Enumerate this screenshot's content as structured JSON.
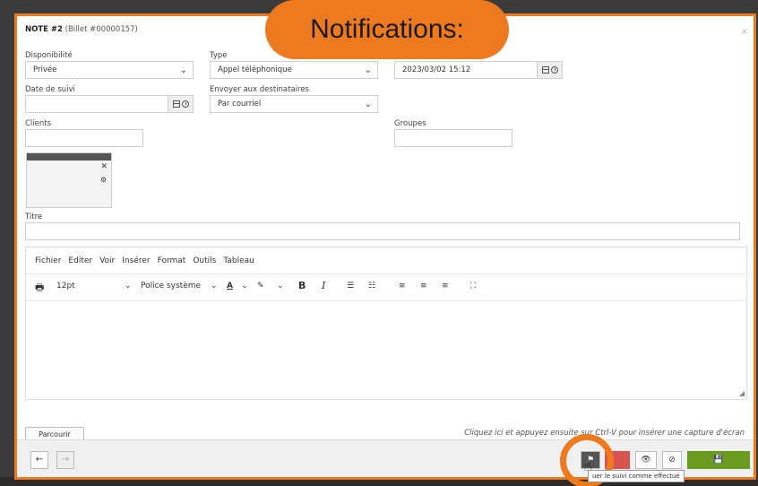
{
  "overlay": {
    "notification_bubble": "Notifications:"
  },
  "modal": {
    "title_bold": "NOTE #2",
    "title_ticket": "(Billet #00000157)",
    "close_glyph": "×"
  },
  "form": {
    "availability": {
      "label": "Disponibilité",
      "value": "Privée"
    },
    "type": {
      "label": "Type",
      "value": "Appel téléphonique"
    },
    "datetime": {
      "value": "2023/03/02 15:12"
    },
    "followup": {
      "label": "Date de suivi",
      "value": ""
    },
    "send_to": {
      "label": "Envoyer aux destinataires",
      "value": "Par courriel"
    },
    "clients": {
      "label": "Clients"
    },
    "groups": {
      "label": "Groupes"
    },
    "title_field": {
      "label": "Titre"
    }
  },
  "editor": {
    "menu": [
      "Fichier",
      "Editer",
      "Voir",
      "Insérer",
      "Format",
      "Outils",
      "Tableau"
    ],
    "font_size": "12pt",
    "font_family": "Police système"
  },
  "attachments": {
    "browse_label": "Parcourir",
    "hint": "Cliquez ici et appuyez ensuite sur Ctrl-V pour insérer une capture d'écran"
  },
  "footer": {
    "tooltip": "uer le suivi comme effectué"
  },
  "colors": {
    "accent": "#ee7a1f",
    "danger": "#d9534f",
    "success": "#6a9a1f"
  }
}
